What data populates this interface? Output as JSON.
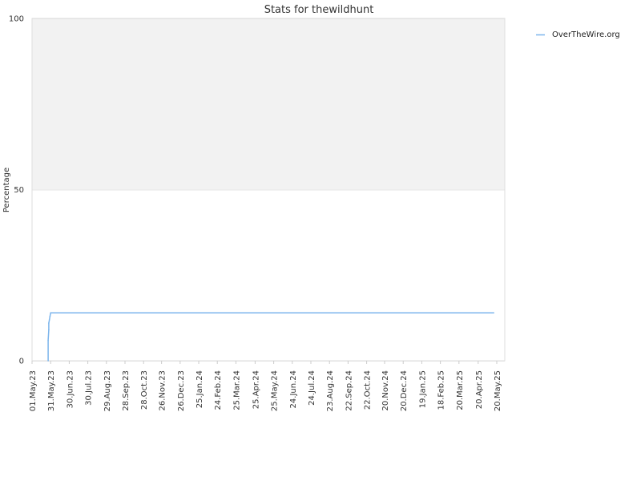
{
  "chart_data": {
    "type": "line",
    "title": "Stats for thewildhunt",
    "xlabel": "",
    "ylabel": "Percentage",
    "ylim": [
      0,
      100
    ],
    "y_ticks": [
      "0",
      "50",
      "100"
    ],
    "x_tick_labels": [
      "01.May.23",
      "31.May.23",
      "30.Jun.23",
      "30.Jul.23",
      "29.Aug.23",
      "28.Sep.23",
      "28.Oct.23",
      "26.Nov.23",
      "26.Dec.23",
      "25.Jan.24",
      "24.Feb.24",
      "25.Mar.24",
      "25.Apr.24",
      "25.May.24",
      "24.Jun.24",
      "24.Jul.24",
      "23.Aug.24",
      "22.Sep.24",
      "22.Oct.24",
      "20.Nov.24",
      "20.Dec.24",
      "19.Jan.25",
      "18.Feb.25",
      "20.Mar.25",
      "20.Apr.25",
      "20.May.25"
    ],
    "grid": true,
    "upper_band_color": "#f2f2f2",
    "legend_position": "top-right",
    "series": [
      {
        "name": "OverTheWire.org",
        "color": "#7cb5ec",
        "points": [
          {
            "x": "2023-05-27",
            "y": 0
          },
          {
            "x": "2023-05-27",
            "y": 6
          },
          {
            "x": "2023-05-28",
            "y": 9
          },
          {
            "x": "2023-05-28",
            "y": 11
          },
          {
            "x": "2023-05-29",
            "y": 12
          },
          {
            "x": "2023-05-30",
            "y": 13
          },
          {
            "x": "2023-05-31",
            "y": 14
          },
          {
            "x": "2025-05-15",
            "y": 14
          }
        ]
      }
    ]
  }
}
